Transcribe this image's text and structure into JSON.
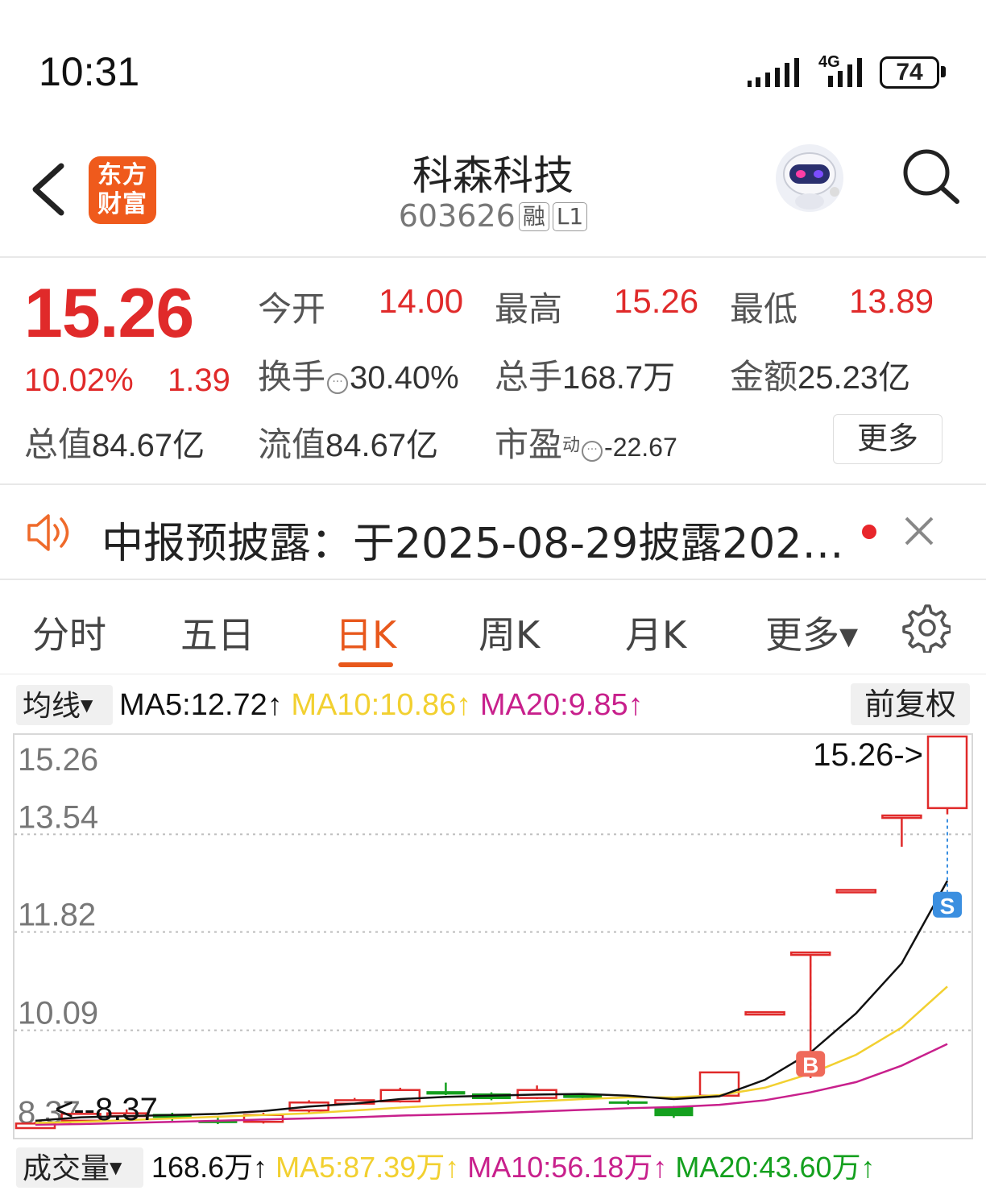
{
  "status_bar": {
    "time": "10:31",
    "network": "4G",
    "battery": "74"
  },
  "header": {
    "logo_line1": "东方",
    "logo_line2": "财富",
    "stock_name": "科森科技",
    "stock_code": "603626",
    "badge_margin": "融",
    "badge_level": "L1"
  },
  "quote": {
    "price": "15.26",
    "change_pct": "10.02%",
    "change": "1.39",
    "open_label": "今开",
    "open": "14.00",
    "high_label": "最高",
    "high": "15.26",
    "low_label": "最低",
    "low": "13.89",
    "turnover_label": "换手",
    "turnover": "30.40%",
    "volume_label": "总手",
    "volume": "168.7万",
    "amount_label": "金额",
    "amount": "25.23亿",
    "mktcap_label": "总值",
    "mktcap": "84.67亿",
    "float_label": "流值",
    "float_cap": "84.67亿",
    "pe_label": "市盈",
    "pe_sup": "动",
    "pe": "-22.67",
    "more_label": "更多"
  },
  "notice": {
    "text": "中报预披露：于2025-08-29披露202…"
  },
  "tabs": {
    "intraday": "分时",
    "five_day": "五日",
    "daily": "日K",
    "weekly": "周K",
    "monthly": "月K",
    "more": "更多▾"
  },
  "ma_bar": {
    "select_label": "均线",
    "ma5": "MA5:12.72↑",
    "ma10": "MA10:10.86↑",
    "ma20": "MA20:9.85↑",
    "adjust_label": "前复权"
  },
  "colors": {
    "up": "#e02a2a",
    "down": "#14a01e",
    "ma5": "#111111",
    "ma10": "#f2d030",
    "ma20": "#c8208c",
    "accent": "#e8581c"
  },
  "chart_data": {
    "type": "candlestick",
    "y_ticks": [
      "15.26",
      "13.54",
      "11.82",
      "10.09",
      "8.37"
    ],
    "ylim": [
      8.37,
      15.26
    ],
    "max_label": "15.26->",
    "min_label": "<--8.37",
    "buy_marker": "B",
    "sell_marker": "S",
    "candles": [
      {
        "open": 8.37,
        "close": 8.45,
        "high": 8.48,
        "low": 8.37
      },
      {
        "open": 8.5,
        "close": 8.62,
        "high": 8.66,
        "low": 8.47
      },
      {
        "open": 8.58,
        "close": 8.63,
        "high": 8.7,
        "low": 8.55
      },
      {
        "open": 8.62,
        "close": 8.55,
        "high": 8.64,
        "low": 8.5
      },
      {
        "open": 8.5,
        "close": 8.47,
        "high": 8.55,
        "low": 8.44
      },
      {
        "open": 8.48,
        "close": 8.6,
        "high": 8.64,
        "low": 8.45
      },
      {
        "open": 8.68,
        "close": 8.82,
        "high": 8.86,
        "low": 8.64
      },
      {
        "open": 8.8,
        "close": 8.86,
        "high": 8.9,
        "low": 8.78
      },
      {
        "open": 8.84,
        "close": 9.04,
        "high": 9.08,
        "low": 8.82
      },
      {
        "open": 9.02,
        "close": 8.96,
        "high": 9.17,
        "low": 8.95
      },
      {
        "open": 8.98,
        "close": 8.88,
        "high": 9.0,
        "low": 8.86
      },
      {
        "open": 8.9,
        "close": 9.04,
        "high": 9.12,
        "low": 8.88
      },
      {
        "open": 8.96,
        "close": 8.9,
        "high": 8.98,
        "low": 8.87
      },
      {
        "open": 8.84,
        "close": 8.8,
        "high": 8.86,
        "low": 8.78
      },
      {
        "open": 8.74,
        "close": 8.58,
        "high": 8.76,
        "low": 8.55
      },
      {
        "open": 8.94,
        "close": 9.35,
        "high": 9.35,
        "low": 8.92
      },
      {
        "open": 10.41,
        "close": 10.41,
        "high": 10.41,
        "low": 10.41
      },
      {
        "open": 11.46,
        "close": 11.46,
        "high": 11.46,
        "low": 9.25
      },
      {
        "open": 12.56,
        "close": 12.56,
        "high": 12.56,
        "low": 12.56
      },
      {
        "open": 13.87,
        "close": 13.87,
        "high": 13.87,
        "low": 13.32
      },
      {
        "open": 14.0,
        "close": 15.26,
        "high": 15.26,
        "low": 13.89
      }
    ],
    "ma5": [
      8.5,
      8.56,
      8.58,
      8.6,
      8.62,
      8.67,
      8.75,
      8.8,
      8.88,
      8.92,
      8.94,
      8.96,
      8.97,
      8.94,
      8.88,
      8.93,
      9.22,
      9.7,
      10.39,
      11.27,
      12.72
    ],
    "ma10": [
      8.46,
      8.48,
      8.51,
      8.54,
      8.57,
      8.6,
      8.63,
      8.68,
      8.73,
      8.77,
      8.8,
      8.84,
      8.88,
      8.91,
      8.91,
      8.95,
      9.08,
      9.33,
      9.66,
      10.14,
      10.86
    ],
    "ma20": [
      8.43,
      8.44,
      8.46,
      8.48,
      8.5,
      8.52,
      8.54,
      8.56,
      8.59,
      8.61,
      8.63,
      8.66,
      8.69,
      8.72,
      8.74,
      8.78,
      8.86,
      9.0,
      9.18,
      9.47,
      9.85
    ]
  },
  "volume_bar": {
    "select_label": "成交量",
    "volume": "168.6万↑",
    "ma5": "MA5:87.39万↑",
    "ma10": "MA10:56.18万↑",
    "ma20": "MA20:43.60万↑"
  }
}
